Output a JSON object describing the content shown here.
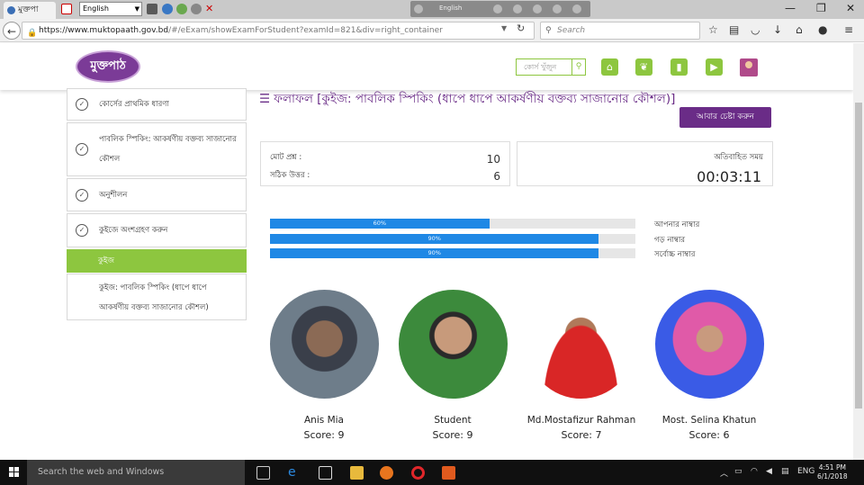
{
  "titlebar": {
    "tab_label": "মুক্তপা",
    "language_selected": "English",
    "center_toolbar_label": "English"
  },
  "navbar": {
    "url_host": "https://www.muktopaath.gov.bd",
    "url_path": "/#/eExam/showExamForStudent?examId=821&div=right_container",
    "search_placeholder": "Search"
  },
  "header": {
    "logo_text": "মুক্তপাঠ",
    "search_placeholder": "কোর্স খুঁজুন"
  },
  "sidebar": {
    "items": [
      {
        "label": "কোর্সের প্রাথমিক ধারণা",
        "checked": true
      },
      {
        "label": "পাবলিক স্পিকিং: আকর্ষণীয় বক্তব্য সাজানোর কৌশল",
        "checked": true
      },
      {
        "label": "অনুশীলন",
        "checked": true
      },
      {
        "label": "কুইজে অংশগ্রহণ করুন",
        "checked": true
      }
    ],
    "active_label": "কুইজ",
    "subitem_label": "কুইজ: পাবলিক স্পিকিং (ধাপে ধাপে আকর্ষণীয় বক্তব্য সাজানোর কৌশল)"
  },
  "main": {
    "result_title": "ফলাফল [কুইজ: পাবলিক স্পিকিং (ধাপে ধাপে আকর্ষণীয় বক্তব্য সাজানোর কৌশল)]",
    "retry_button": "আবার চেষ্টা করুন",
    "total_questions_label": "মোট প্রশ্ন :",
    "total_questions_value": "10",
    "correct_answers_label": "সঠিক উত্তর :",
    "correct_answers_value": "6",
    "elapsed_label": "অতিবাহিত সময়",
    "elapsed_value": "00:03:11",
    "progress": [
      {
        "label": "আপনার নাম্বার",
        "percent": 60,
        "text": "60%"
      },
      {
        "label": "গড় নাম্বার",
        "percent": 90,
        "text": "90%"
      },
      {
        "label": "সর্বোচ্চ নাম্বার",
        "percent": 90,
        "text": "90%"
      }
    ],
    "leaderboard": [
      {
        "name": "Anis Mia",
        "score": "Score: 9"
      },
      {
        "name": "Student",
        "score": "Score: 9"
      },
      {
        "name": "Md.Mostafizur Rahman",
        "score": "Score: 7"
      },
      {
        "name": "Most. Selina Khatun",
        "score": "Score: 6"
      }
    ]
  },
  "taskbar": {
    "search_placeholder": "Search the web and Windows",
    "language": "ENG",
    "time": "4:51 PM",
    "date": "6/1/2018"
  },
  "colors": {
    "brand_purple": "#6a2c87",
    "accent_green": "#8dc63f",
    "progress_blue": "#1f88e5"
  }
}
